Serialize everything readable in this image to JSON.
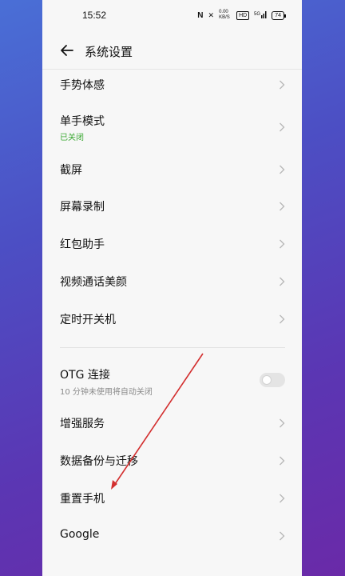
{
  "status_bar": {
    "time": "15:52",
    "nfc": "N",
    "speed": "0.00 KB/S",
    "hd": "HD",
    "signal": "5G",
    "battery": "74"
  },
  "header": {
    "title": "系统设置"
  },
  "items": [
    {
      "label": "手势体感"
    },
    {
      "label": "单手模式",
      "sub": "已关闭",
      "sub_color": "#3aa832"
    },
    {
      "label": "截屏"
    },
    {
      "label": "屏幕录制"
    },
    {
      "label": "红包助手"
    },
    {
      "label": "视频通话美颜"
    },
    {
      "label": "定时开关机"
    },
    {
      "label": "OTG 连接",
      "sub": "10 分钟未使用将自动关闭",
      "sub_color": "#8a8a8a",
      "toggle": false
    },
    {
      "label": "增强服务"
    },
    {
      "label": "数据备份与迁移"
    },
    {
      "label": "重置手机"
    },
    {
      "label": "Google"
    }
  ],
  "colors": {
    "annotation_arrow": "#d32f2f"
  }
}
